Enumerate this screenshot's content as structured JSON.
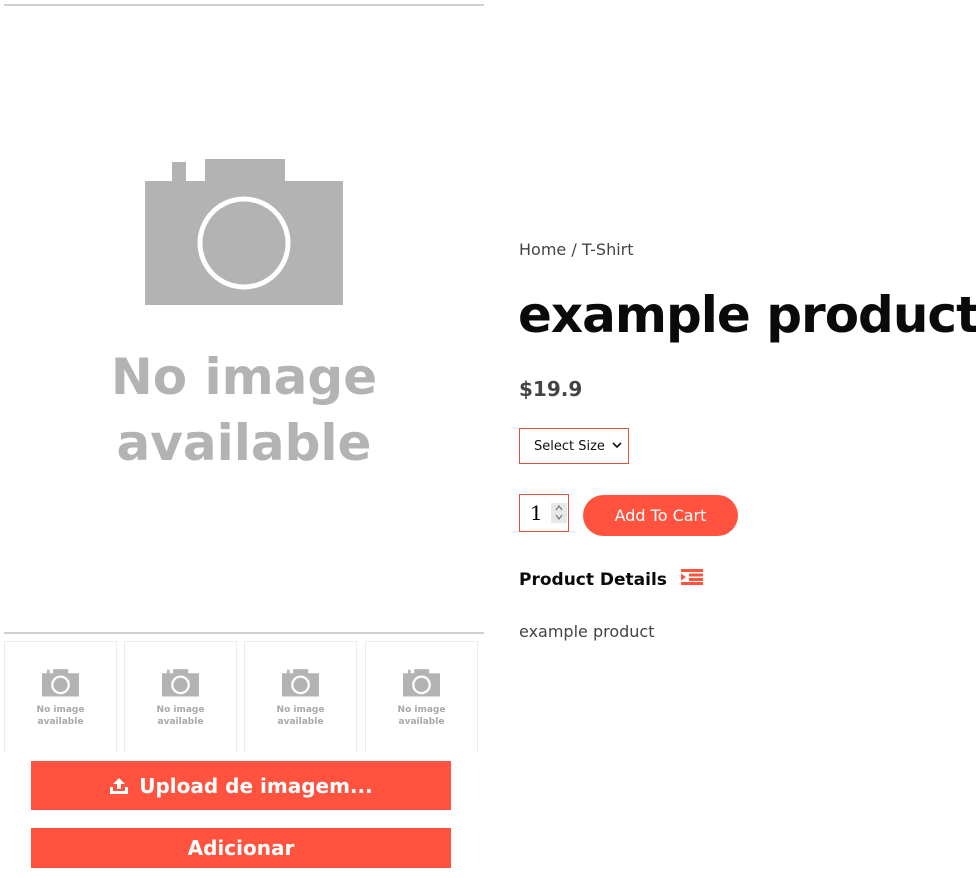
{
  "gallery": {
    "main_image": {
      "icon": "camera-icon",
      "line1": "No image",
      "line2": "available"
    },
    "thumbnails": [
      {
        "line1": "No image",
        "line2": "available",
        "icon": "camera-icon"
      },
      {
        "line1": "No image",
        "line2": "available",
        "icon": "camera-icon"
      },
      {
        "line1": "No image",
        "line2": "available",
        "icon": "camera-icon"
      },
      {
        "line1": "No image",
        "line2": "available",
        "icon": "camera-icon"
      }
    ],
    "upload_button": {
      "label": "Upload de imagem...",
      "icon": "upload-icon"
    },
    "add_button": {
      "label": "Adicionar"
    }
  },
  "product": {
    "breadcrumb": {
      "home": "Home",
      "separator": "/",
      "category": "T-Shirt"
    },
    "title": "example product",
    "price": "$19.9",
    "size_select": {
      "selected": "Select Size"
    },
    "quantity": "1",
    "add_to_cart": "Add To Cart",
    "details_heading": "Product Details",
    "details_icon": "list-indent-icon",
    "description": "example product"
  },
  "colors": {
    "accent": "#ff533f",
    "placeholder_gray": "#b3b3b3"
  }
}
